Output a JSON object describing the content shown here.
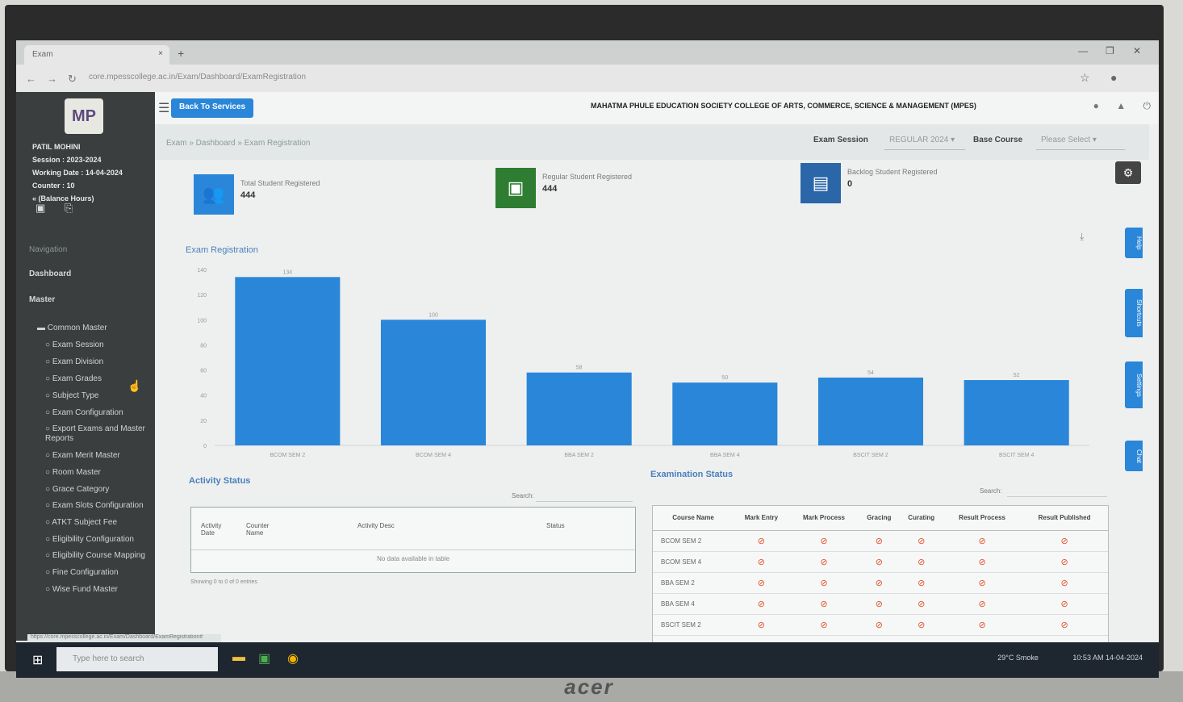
{
  "browser": {
    "tab_label": "Exam",
    "tab_close": "×",
    "new_tab": "+",
    "url": "core.mpesscollege.ac.in/Exam/Dashboard/ExamRegistration"
  },
  "sidebar": {
    "logo_text": "MP",
    "user_name": "PATIL MOHINI",
    "session": "Session : 2023-2024",
    "working_date": "Working Date : 14-04-2024",
    "counter": "Counter : 10",
    "balance": "« (Balance Hours)",
    "section_label": "Navigation",
    "dashboard": "Dashboard",
    "master": "Master",
    "menu_items": [
      "Common Master",
      "Exam Session",
      "Exam Division",
      "Exam Grades",
      "Subject Type",
      "Exam Configuration",
      "Export Exams and Master Reports",
      "Exam Merit Master",
      "Room Master",
      "Grace Category",
      "Exam Slots Configuration",
      "ATKT Subject Fee",
      "Eligibility Configuration",
      "Eligibility Course Mapping",
      "Fine Configuration",
      "Wise Fund Master"
    ]
  },
  "topbar": {
    "switch_label": "Back To Services",
    "college_name": "MAHATMA PHULE EDUCATION SOCIETY COLLEGE OF ARTS, COMMERCE, SCIENCE & MANAGEMENT (MPES)"
  },
  "filters": {
    "breadcrumb": "Exam » Dashboard » Exam Registration",
    "exam_session_label": "Exam Session",
    "exam_session_value": "REGULAR 2024",
    "base_course_label": "Base Course",
    "base_course_value": "Please Select"
  },
  "stats": [
    {
      "label": "Total Student Registered",
      "value": "444",
      "color": "#2a86d8"
    },
    {
      "label": "Regular Student Registered",
      "value": "444",
      "color": "#2e7d32"
    },
    {
      "label": "Backlog Student Registered",
      "value": "0",
      "color": "#2b66a8"
    }
  ],
  "chart": {
    "title": "Exam Registration"
  },
  "chart_data": {
    "type": "bar",
    "title": "Exam Registration",
    "categories": [
      "BCOM SEM 2",
      "BCOM SEM 4",
      "BBA SEM 2",
      "BBA SEM 4",
      "BSCIT SEM 2",
      "BSCIT SEM 4"
    ],
    "values": [
      134,
      100,
      58,
      50,
      54,
      52
    ],
    "data_labels": [
      "134",
      "100",
      "58",
      "50",
      "54",
      "52"
    ],
    "ylim": [
      0,
      140
    ],
    "yticks": [
      0,
      20,
      40,
      60,
      80,
      100,
      120,
      140
    ],
    "color": "#2a86d8",
    "grid": false
  },
  "side_tabs": [
    "Help",
    "Shortcuts",
    "Settings",
    "Chat"
  ],
  "activity": {
    "title": "Activity Status",
    "search_label": "Search:",
    "headers": [
      "Activity Date",
      "Counter Name",
      "Activity Desc",
      "Status"
    ],
    "empty_text": "No data available in table",
    "showing": "Showing 0 to 0 of 0 entries"
  },
  "exam_status": {
    "title": "Examination Status",
    "search_label": "Search:",
    "headers": [
      "Course Name",
      "Mark Entry",
      "Mark Process",
      "Gracing",
      "Curating",
      "Result Process",
      "Result Published"
    ],
    "rows": [
      "BCOM SEM 2",
      "BCOM SEM 4",
      "BBA SEM 2",
      "BBA SEM 4",
      "BSCIT SEM 2"
    ],
    "status_icon": "⊘"
  },
  "status_url": "https://core.mpesscollege.ac.in/Exam/Dashboard/ExamRegistration#",
  "taskbar": {
    "search_placeholder": "Type here to search",
    "weather": "29°C Smoke",
    "clock": "10:53 AM 14-04-2024"
  },
  "monitor_brand": "acer"
}
